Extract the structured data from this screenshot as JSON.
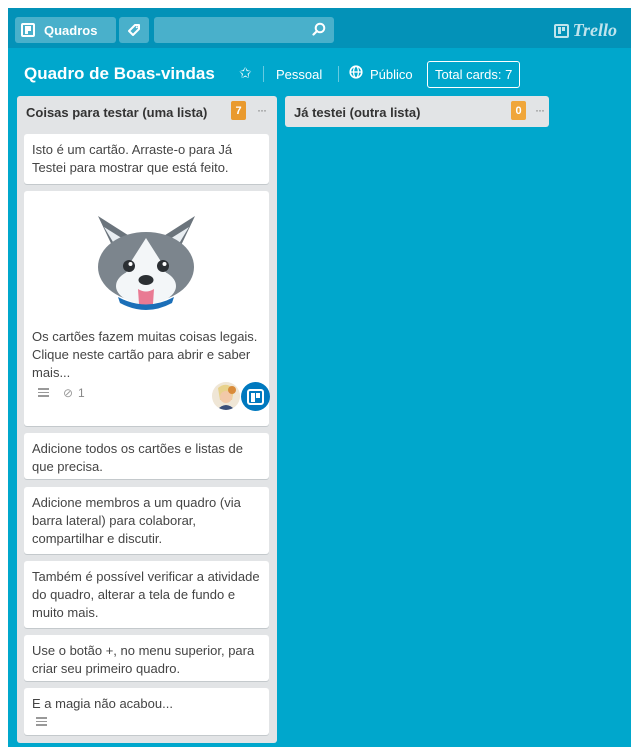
{
  "header": {
    "boards_button_label": "Quadros",
    "tag_icon": "tag-icon",
    "search_placeholder": "",
    "logo_text": "Trello"
  },
  "board": {
    "title": "Quadro de Boas-vindas",
    "visibility_team": "Pessoal",
    "visibility_public": "Público",
    "total_cards": "Total cards: 7"
  },
  "lists": [
    {
      "title": "Coisas para testar (uma lista)",
      "count": "7",
      "menu": "···",
      "cards": [
        {
          "text": "Isto é um cartão. Arraste-o para Já Testei para mostrar que está feito."
        },
        {
          "text": "Os cartões fazem muitas coisas legais. Clique neste cartão para abrir e saber mais...",
          "attachments": "1",
          "cover": "husky-dog-image"
        },
        {
          "text": "Adicione todos os cartões e listas de que precisa."
        },
        {
          "text": "Adicione membros a um quadro (via barra lateral) para colaborar, compartilhar e discutir."
        },
        {
          "text": "Também é possível verificar a atividade do quadro, alterar a tela de fundo e muito mais."
        },
        {
          "text": "Use o botão +, no menu superior, para criar seu primeiro quadro."
        },
        {
          "text": "E a magia não acabou..."
        }
      ]
    },
    {
      "title": "Já testei (outra lista)",
      "count": "0",
      "menu": "···",
      "cards": []
    }
  ],
  "colors": {
    "board_background": "#00a7cc",
    "header_background": "#0392b8",
    "list_background": "#e2e4e6",
    "badge_orange": "#e99a2f"
  }
}
